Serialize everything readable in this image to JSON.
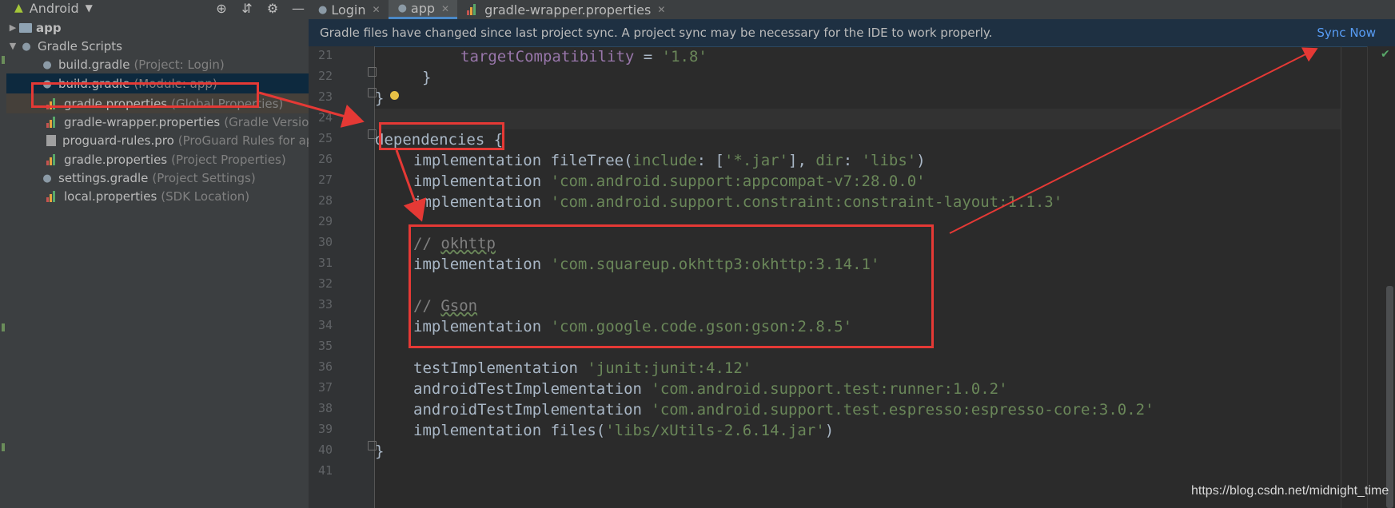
{
  "project_panel": {
    "view_label": "Android",
    "tree": [
      {
        "name": "app",
        "hint": ""
      },
      {
        "name": "Gradle Scripts",
        "hint": ""
      },
      {
        "name": "build.gradle",
        "hint": "(Project: Login)"
      },
      {
        "name": "build.gradle",
        "hint": "(Module: app)"
      },
      {
        "name": "gradle.properties",
        "hint": "(Global Properties)"
      },
      {
        "name": "gradle-wrapper.properties",
        "hint": "(Gradle Version"
      },
      {
        "name": "proguard-rules.pro",
        "hint": "(ProGuard Rules for ap"
      },
      {
        "name": "gradle.properties",
        "hint": "(Project Properties)"
      },
      {
        "name": "settings.gradle",
        "hint": "(Project Settings)"
      },
      {
        "name": "local.properties",
        "hint": "(SDK Location)"
      }
    ]
  },
  "tabs": [
    {
      "label": "Login"
    },
    {
      "label": "app"
    },
    {
      "label": "gradle-wrapper.properties"
    }
  ],
  "banner": {
    "message": "Gradle files have changed since last project sync. A project sync may be necessary for the IDE to work properly.",
    "action": "Sync Now"
  },
  "code": {
    "line_numbers": [
      "21",
      "22",
      "23",
      "24",
      "25",
      "26",
      "27",
      "28",
      "29",
      "30",
      "31",
      "32",
      "33",
      "34",
      "35",
      "36",
      "37",
      "38",
      "39",
      "40",
      "41"
    ],
    "l21_prop": "targetCompatibility",
    "l21_eq": " = ",
    "l21_str": "'1.8'",
    "l22": "}",
    "l23": "}",
    "l25_kw": "dependencies",
    "l25_brace": " {",
    "l26_a": "implementation fileTree(",
    "l26_b": "include",
    "l26_c": ": [",
    "l26_d": "'*.jar'",
    "l26_e": "], ",
    "l26_f": "dir",
    "l26_g": ": ",
    "l26_h": "'libs'",
    "l26_i": ")",
    "l27_a": "implementation ",
    "l27_b": "'com.android.support:appcompat-v7:28.0.0'",
    "l28_a": "implementation ",
    "l28_b": "'com.android.support.constraint:constraint-layout:1.1.3'",
    "l30_a": "// ",
    "l30_b": "okhttp",
    "l31_a": "implementation ",
    "l31_b": "'com.squareup.okhttp3:okhttp:3.14.1'",
    "l33_a": "// ",
    "l33_b": "Gson",
    "l34_a": "implementation ",
    "l34_b": "'com.google.code.gson:gson:2.8.5'",
    "l36_a": "testImplementation ",
    "l36_b": "'junit:junit:4.12'",
    "l37_a": "androidTestImplementation ",
    "l37_b": "'com.android.support.test:runner:1.0.2'",
    "l38_a": "androidTestImplementation ",
    "l38_b": "'com.android.support.test.espresso:espresso-core:3.0.2'",
    "l39_a": "implementation files(",
    "l39_b": "'libs/xUtils-2.6.14.jar'",
    "l39_c": ")",
    "l40": "}"
  },
  "watermark": "https://blog.csdn.net/midnight_time",
  "colors": {
    "annotation_red": "#e53935",
    "string_green": "#6a8759",
    "property_purple": "#9876aa",
    "link_blue": "#589df6"
  }
}
